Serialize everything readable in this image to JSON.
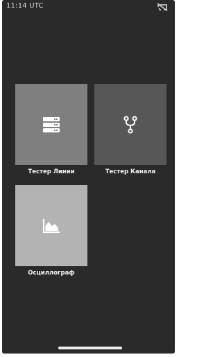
{
  "status_bar": {
    "time": "11:14 UTC",
    "connection_icon": "cast-disconnected-icon"
  },
  "tiles": [
    {
      "label": "Тестер Линии",
      "icon": "server-icon"
    },
    {
      "label": "Тестер Канала",
      "icon": "branch-fork-icon"
    },
    {
      "label": "Осциллограф",
      "icon": "area-chart-icon"
    }
  ],
  "colors": {
    "background": "#2a2a2a",
    "tile_line_tester": "#7f7f7f",
    "tile_channel_tester": "#575757",
    "tile_oscilloscope": "#b3b3b3",
    "text": "#f2f2f2"
  }
}
